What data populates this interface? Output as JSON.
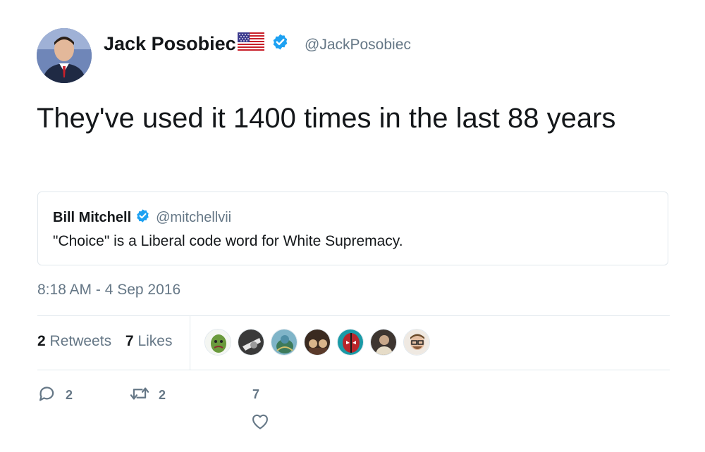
{
  "author": {
    "name": "Jack Posobiec",
    "handle": "@JackPosobiec",
    "flag_icon": "us-flag-icon",
    "verified_icon": "verified-badge-icon"
  },
  "tweet": {
    "text": "They've used it 1400 times in the last 88 years",
    "timestamp": "8:18 AM - 4 Sep 2016"
  },
  "quoted_tweet": {
    "name": "Bill Mitchell",
    "handle": "@mitchellvii",
    "text": "\"Choice\" is a Liberal code word for White Supremacy."
  },
  "stats": {
    "retweets_count": "2",
    "retweets_label": "Retweets",
    "likes_count": "7",
    "likes_label": "Likes"
  },
  "likers": [
    {
      "icon": "liker-avatar-1",
      "color": "#6a9a3c"
    },
    {
      "icon": "liker-avatar-2",
      "color": "#3a3a3a"
    },
    {
      "icon": "liker-avatar-3",
      "color": "#4f8fa6"
    },
    {
      "icon": "liker-avatar-4",
      "color": "#5a3a2a"
    },
    {
      "icon": "liker-avatar-5",
      "color": "#b8262b"
    },
    {
      "icon": "liker-avatar-6",
      "color": "#6b5d4e"
    },
    {
      "icon": "liker-avatar-7",
      "color": "#c9b49a"
    }
  ],
  "actions": {
    "reply_count": "2",
    "retweet_count": "2",
    "like_count": "7"
  },
  "colors": {
    "verified": "#1da1f2",
    "secondary_text": "#657786",
    "border": "#e1e8ed"
  }
}
